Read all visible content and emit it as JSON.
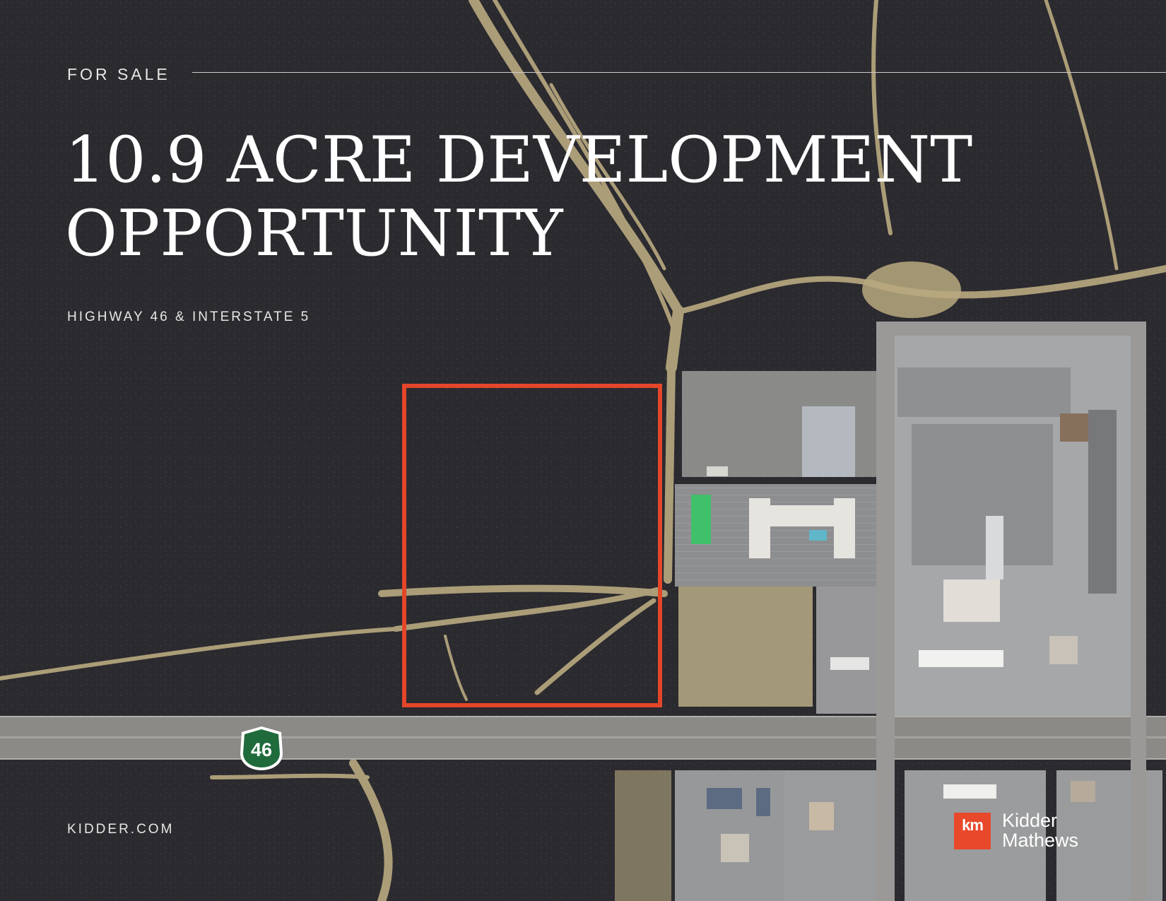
{
  "header": {
    "eyebrow": "FOR SALE"
  },
  "headline": {
    "line1": "10.9 ACRE DEVELOPMENT",
    "line2": "OPPORTUNITY"
  },
  "location": "HIGHWAY 46 & INTERSTATE 5",
  "footer": {
    "website": "KIDDER.COM"
  },
  "brand": {
    "mark": "km",
    "name_line1": "Kidder",
    "name_line2": "Mathews",
    "color": "#e8492b"
  },
  "map": {
    "route_shield": "46",
    "shield_color": "#1f6b3c",
    "parcel_outline_color": "#e4462a",
    "base_color": "#2b2a2f",
    "road_color": "#8b8a86",
    "dirt_color": "#c9b98e"
  }
}
